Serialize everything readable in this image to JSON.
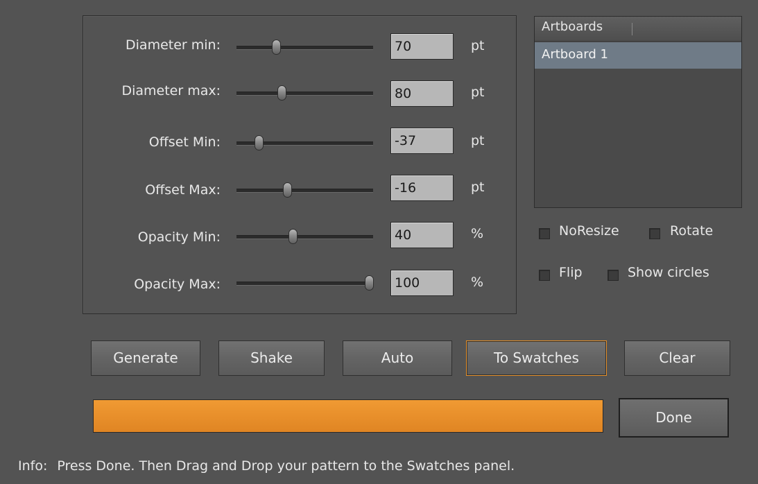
{
  "settings": {
    "rows": [
      {
        "label": "Diameter min:",
        "value": "70",
        "unit": "pt",
        "slider_fraction": 0.29
      },
      {
        "label": "Diameter max:",
        "value": "80",
        "unit": "pt",
        "slider_fraction": 0.33
      },
      {
        "label": "Offset Min:",
        "value": "-37",
        "unit": "pt",
        "slider_fraction": 0.16
      },
      {
        "label": "Offset Max:",
        "value": "-16",
        "unit": "pt",
        "slider_fraction": 0.37
      },
      {
        "label": "Opacity Min:",
        "value": "40",
        "unit": "%",
        "slider_fraction": 0.41
      },
      {
        "label": "Opacity Max:",
        "value": "100",
        "unit": "%",
        "slider_fraction": 0.97
      }
    ]
  },
  "artboards": {
    "header": "Artboards",
    "items": [
      "Artboard 1"
    ]
  },
  "options": {
    "noresize": {
      "label": "NoResize",
      "checked": false
    },
    "rotate": {
      "label": "Rotate",
      "checked": false
    },
    "flip": {
      "label": "Flip",
      "checked": false
    },
    "show_circles": {
      "label": "Show circles",
      "checked": false
    }
  },
  "buttons": {
    "generate": "Generate",
    "shake": "Shake",
    "auto": "Auto",
    "to_swatches": "To Swatches",
    "clear": "Clear",
    "done": "Done"
  },
  "progress": {
    "fraction": 1.0
  },
  "info": {
    "label": "Info:",
    "text": "Press Done. Then Drag and Drop your pattern to the Swatches panel."
  },
  "colors": {
    "background": "#535353",
    "accent": "#e8922b",
    "selection": "#6f7b87"
  }
}
